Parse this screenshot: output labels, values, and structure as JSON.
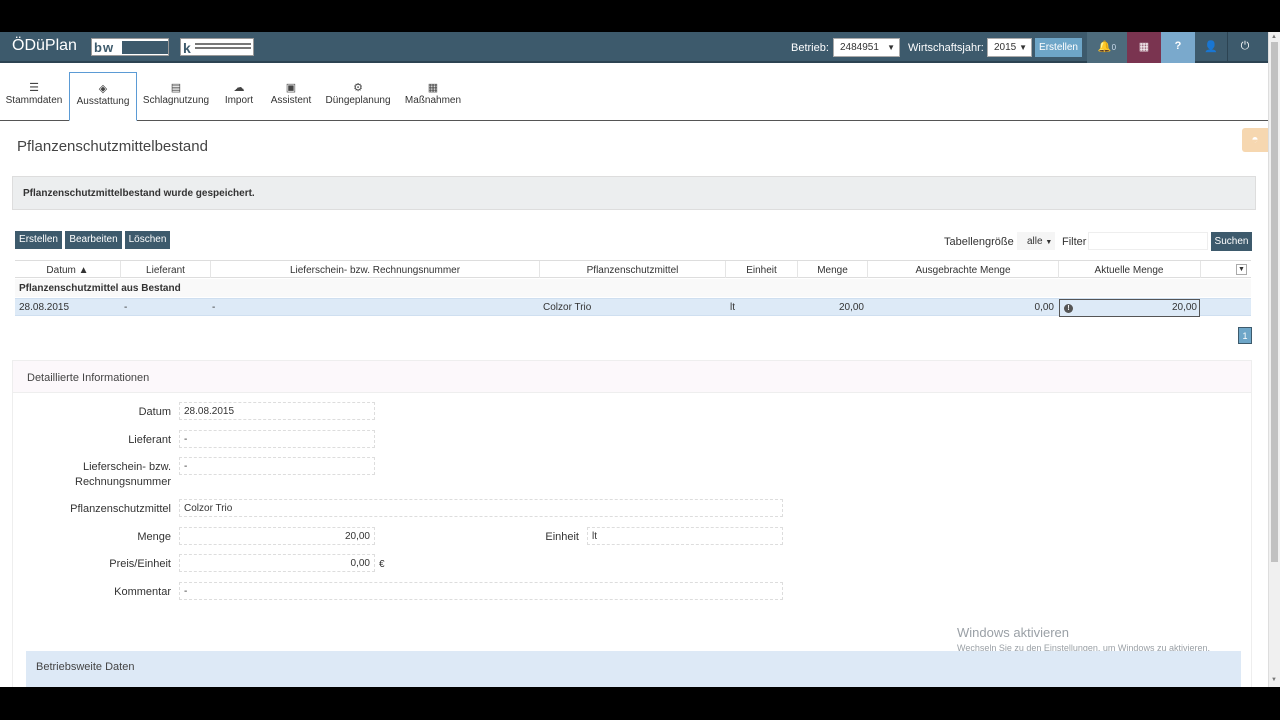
{
  "app": {
    "title": "ÖDüPlan"
  },
  "topbar": {
    "betrieb_label": "Betrieb:",
    "betrieb_value": "2484951",
    "wirtschaftsjahr_label": "Wirtschaftsjahr:",
    "wirtschaftsjahr_value": "2015",
    "erstellen_label": "Erstellen",
    "notification_count": "0",
    "help_label": "?"
  },
  "nav": {
    "items": [
      {
        "label": "Stammdaten",
        "icon": "database-icon"
      },
      {
        "label": "Ausstattung",
        "icon": "cube-icon"
      },
      {
        "label": "Schlagnutzung",
        "icon": "field-icon"
      },
      {
        "label": "Import",
        "icon": "cloud-upload-icon"
      },
      {
        "label": "Assistent",
        "icon": "wizard-icon"
      },
      {
        "label": "Düngeplanung",
        "icon": "gears-icon"
      },
      {
        "label": "Maßnahmen",
        "icon": "calendar-icon"
      }
    ],
    "active": "Ausstattung"
  },
  "page": {
    "title": "Pflanzenschutzmittelbestand",
    "alert": "Pflanzenschutzmittelbestand wurde gespeichert."
  },
  "toolbar": {
    "erstellen": "Erstellen",
    "bearbeiten": "Bearbeiten",
    "loeschen": "Löschen",
    "tabellengroesse_label": "Tabellengröße",
    "tabellengroesse_value": "alle",
    "filter_label": "Filter",
    "filter_value": "",
    "suchen": "Suchen"
  },
  "table": {
    "columns": [
      "Datum ▲",
      "Lieferant",
      "Lieferschein- bzw. Rechnungsnummer",
      "Pflanzenschutzmittel",
      "Einheit",
      "Menge",
      "Ausgebrachte Menge",
      "Aktuelle Menge"
    ],
    "group_label": "Pflanzenschutzmittel aus Bestand",
    "rows": [
      {
        "datum": "28.08.2015",
        "lieferant": "-",
        "nummer": "-",
        "mittel": "Colzor Trio",
        "einheit": "lt",
        "menge": "20,00",
        "ausgebracht": "0,00",
        "aktuell": "20,00"
      }
    ],
    "page": "1"
  },
  "details": {
    "title": "Detaillierte Informationen",
    "datum_label": "Datum",
    "datum_value": "28.08.2015",
    "lieferant_label": "Lieferant",
    "lieferant_value": "-",
    "nummer_label_1": "Lieferschein- bzw.",
    "nummer_label_2": "Rechnungsnummer",
    "nummer_value": "-",
    "mittel_label": "Pflanzenschutzmittel",
    "mittel_value": "Colzor Trio",
    "menge_label": "Menge",
    "menge_value": "20,00",
    "einheit_label": "Einheit",
    "einheit_value": "lt",
    "preis_label": "Preis/Einheit",
    "preis_value": "0,00",
    "currency": "€",
    "kommentar_label": "Kommentar",
    "kommentar_value": "-"
  },
  "betriebsweite": {
    "title": "Betriebsweite Daten"
  },
  "watermark": {
    "line1": "Windows aktivieren",
    "line2": "Wechseln Sie zu den Einstellungen, um Windows zu aktivieren."
  },
  "colors": {
    "topbar": "#3d5a6c",
    "accent": "#6ea6c8",
    "row_selected": "#ddeaf7"
  }
}
